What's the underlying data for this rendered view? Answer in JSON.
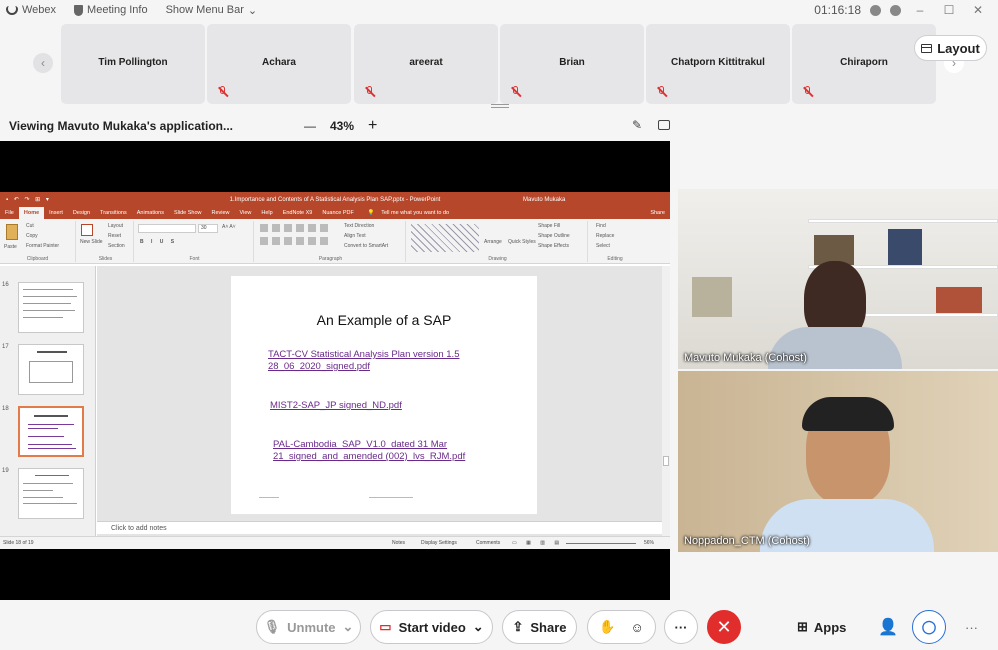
{
  "topbar": {
    "app_name": "Webex",
    "meeting_info": "Meeting Info",
    "show_menu_bar": "Show Menu Bar",
    "time": "01:16:18"
  },
  "participants": [
    {
      "name": "Tim Pollington",
      "muted": false
    },
    {
      "name": "Achara",
      "muted": true
    },
    {
      "name": "areerat",
      "muted": true
    },
    {
      "name": "Brian",
      "muted": true
    },
    {
      "name": "Chatporn Kittitrakul",
      "muted": true
    },
    {
      "name": "Chiraporn",
      "muted": true
    }
  ],
  "layout_button": "Layout",
  "viewing": {
    "label": "Viewing Mavuto Mukaka's application...",
    "zoom_minus": "—",
    "zoom": "43%",
    "zoom_plus": "+"
  },
  "powerpoint": {
    "window_title": "1.Importance and Contents of A Statistical Analysis Plan SAP.pptx - PowerPoint",
    "user": "Mavuto Mukaka",
    "tabs": [
      "File",
      "Home",
      "Insert",
      "Design",
      "Transitions",
      "Animations",
      "Slide Show",
      "Review",
      "View",
      "Help",
      "EndNote X9",
      "Nuance PDF"
    ],
    "tell_me": "Tell me what you want to do",
    "share": "Share",
    "ribbon": {
      "clipboard": "Clipboard",
      "paste": "Paste",
      "cut": "Cut",
      "copy": "Copy",
      "format_painter": "Format Painter",
      "slides": "Slides",
      "new_slide": "New Slide",
      "layout": "Layout",
      "reset": "Reset",
      "section": "Section",
      "font": "Font",
      "font_size": "30",
      "paragraph": "Paragraph",
      "text_direction": "Text Direction",
      "align_text": "Align Text",
      "convert_smartart": "Convert to SmartArt",
      "drawing": "Drawing",
      "arrange": "Arrange",
      "quick_styles": "Quick Styles",
      "shape_fill": "Shape Fill",
      "shape_outline": "Shape Outline",
      "shape_effects": "Shape Effects",
      "editing": "Editing",
      "find": "Find",
      "replace": "Replace",
      "select": "Select"
    },
    "thumbnails": [
      {
        "num": "16",
        "selected": false
      },
      {
        "num": "17",
        "selected": false
      },
      {
        "num": "18",
        "selected": true
      },
      {
        "num": "19",
        "selected": false
      }
    ],
    "slide": {
      "title": "An Example of a SAP",
      "links": [
        "TACT-CV Statistical Analysis Plan version 1.5\n28_06_2020_signed.pdf",
        "MIST2-SAP_JP signed_ND.pdf",
        "PAL-Cambodia_SAP_V1.0_dated 31 Mar\n21_signed_and_amended (002)_lvs_RJM.pdf"
      ]
    },
    "notes_placeholder": "Click to add notes",
    "status": {
      "slide_count": "Slide 18 of 19",
      "notes": "Notes",
      "display_settings": "Display Settings",
      "comments": "Comments",
      "zoom": "56%"
    }
  },
  "videos": [
    {
      "name": "Mavuto Mukaka (Cohost)"
    },
    {
      "name": "Noppadon_CTM (Cohost)"
    }
  ],
  "controls": {
    "unmute": "Unmute",
    "start_video": "Start video",
    "share": "Share",
    "apps": "Apps",
    "more": "···"
  }
}
